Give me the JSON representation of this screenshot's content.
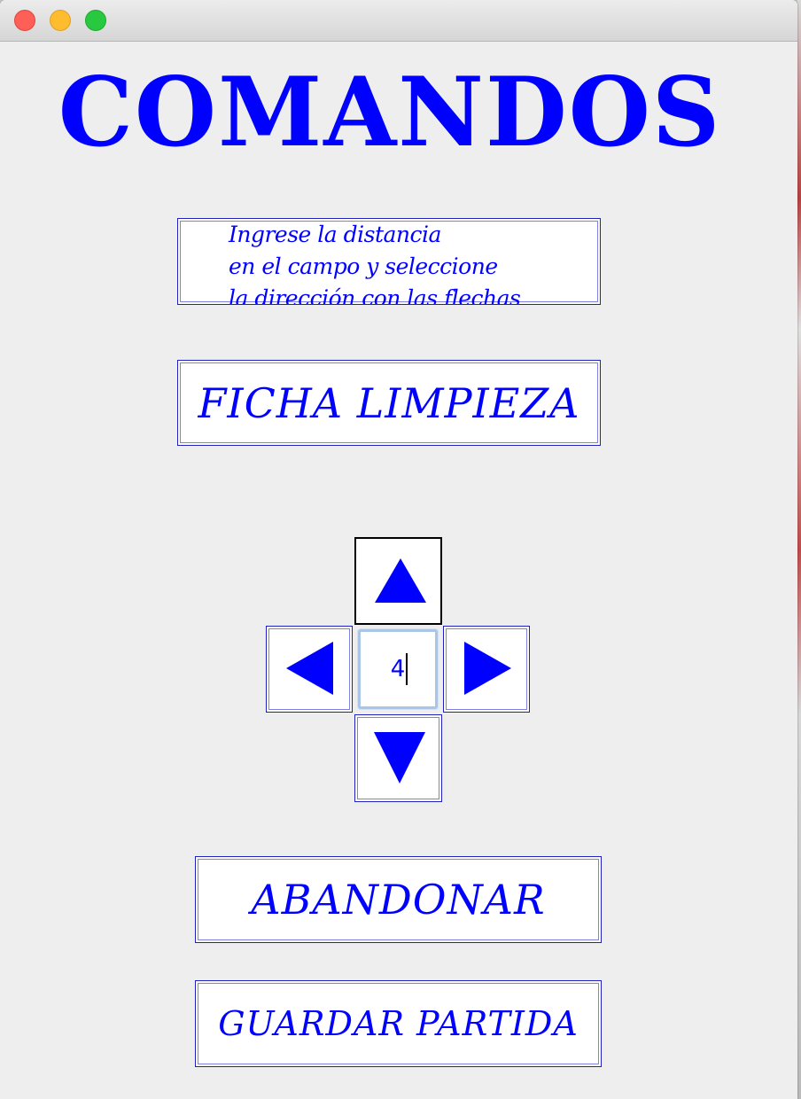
{
  "window": {
    "controls": [
      "close",
      "minimize",
      "zoom"
    ]
  },
  "title": "COMANDOS",
  "instructions": {
    "lines": [
      "Ingrese la distancia",
      "en el campo y seleccione",
      "la dirección con las flechas"
    ]
  },
  "buttons": {
    "ficha_limpieza": "FICHA LIMPIEZA",
    "abandonar": "ABANDONAR",
    "guardar_partida": "GUARDAR PARTIDA"
  },
  "dpad": {
    "up_icon": "arrow-up-icon",
    "down_icon": "arrow-down-icon",
    "left_icon": "arrow-left-icon",
    "right_icon": "arrow-right-icon",
    "distance_value": "4"
  },
  "colors": {
    "accent": "#0000ff",
    "background": "#eeeeee",
    "button_bg": "#ffffff",
    "button_border": "#2020c0"
  }
}
